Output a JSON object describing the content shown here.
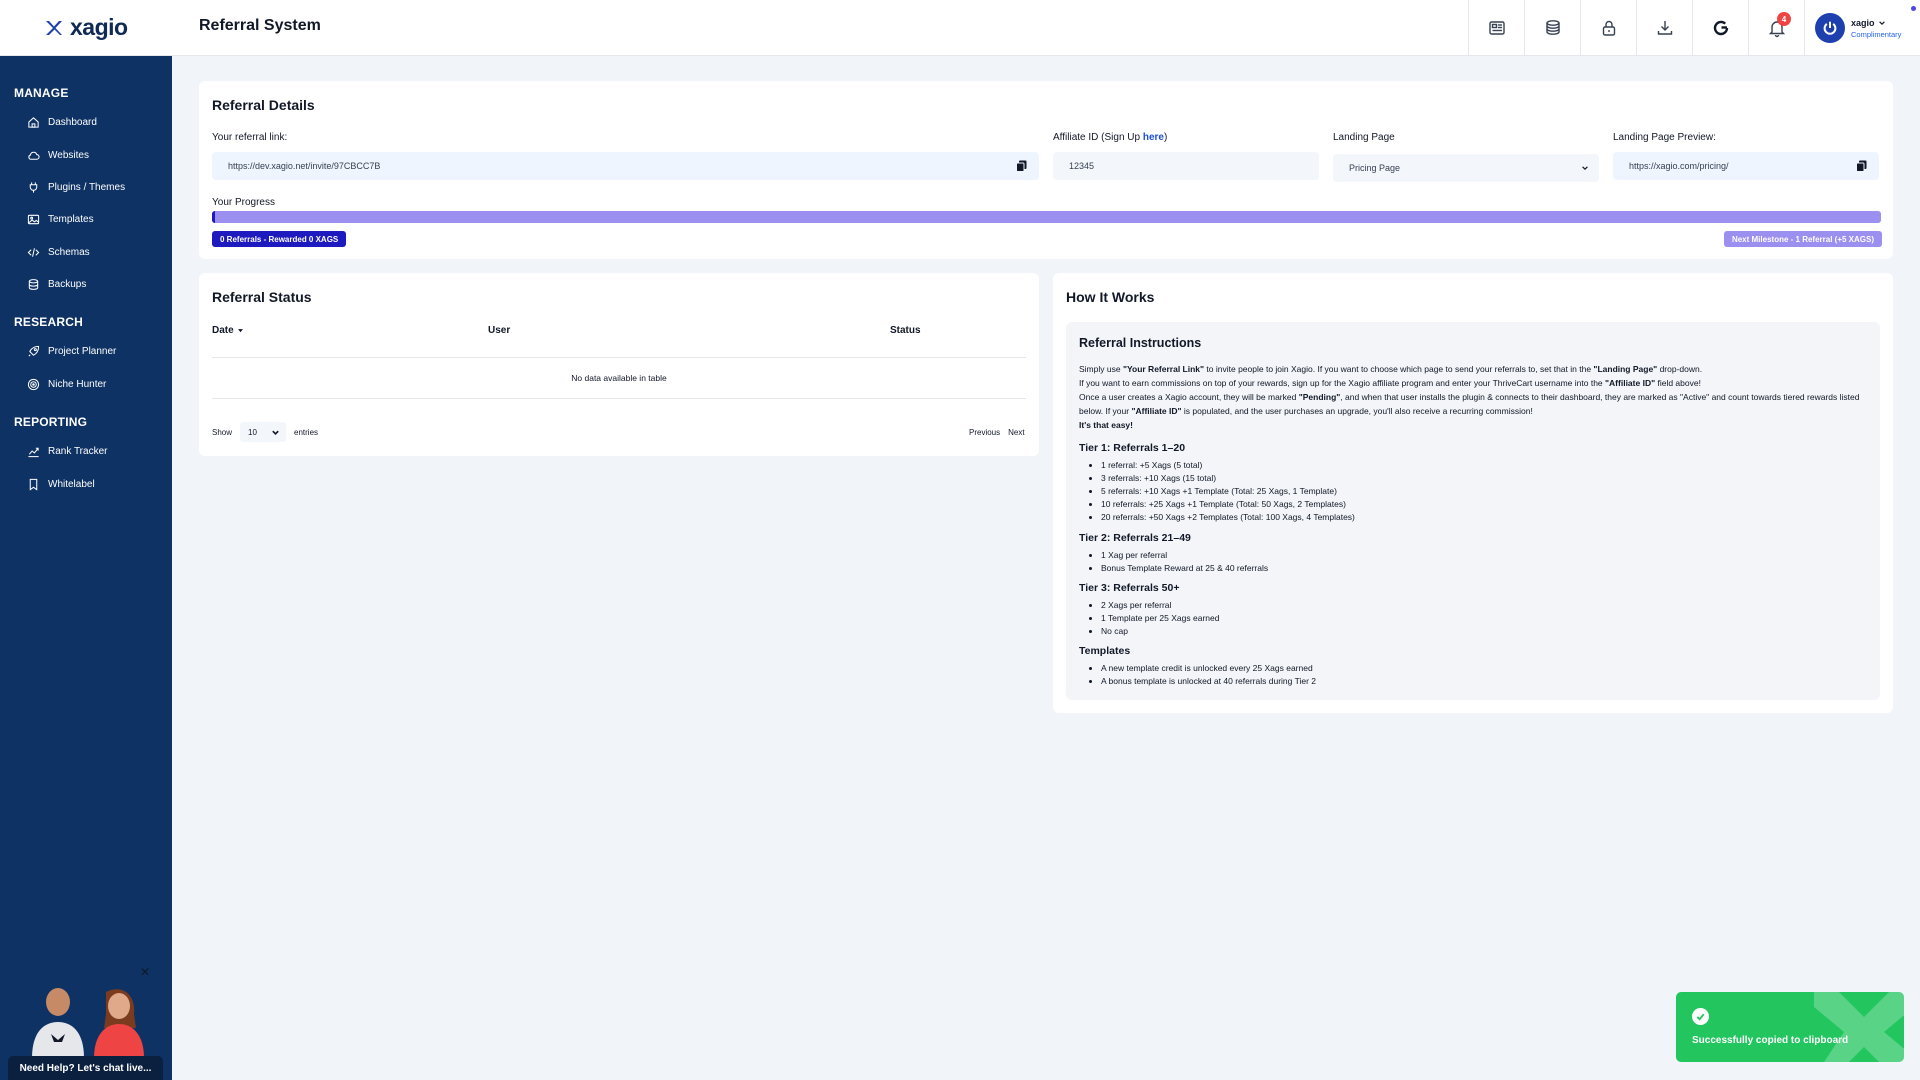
{
  "app": {
    "logo_text": "xagio",
    "page_title": "Referral System"
  },
  "header": {
    "icons": [
      "newspaper-icon",
      "coins-icon",
      "lock-icon",
      "download-icon",
      "google-icon",
      "bell-icon"
    ],
    "notification_count": "4",
    "user_name": "xagio",
    "user_plan": "Complimentary"
  },
  "sidebar": {
    "sections": [
      {
        "label": "MANAGE",
        "items": [
          {
            "label": "Dashboard",
            "icon": "home-icon"
          },
          {
            "label": "Websites",
            "icon": "cloud-icon"
          },
          {
            "label": "Plugins / Themes",
            "icon": "plug-icon"
          },
          {
            "label": "Templates",
            "icon": "image-icon"
          },
          {
            "label": "Schemas",
            "icon": "code-icon"
          },
          {
            "label": "Backups",
            "icon": "database-icon"
          }
        ]
      },
      {
        "label": "RESEARCH",
        "items": [
          {
            "label": "Project Planner",
            "icon": "rocket-icon"
          },
          {
            "label": "Niche Hunter",
            "icon": "target-icon"
          }
        ]
      },
      {
        "label": "REPORTING",
        "items": [
          {
            "label": "Rank Tracker",
            "icon": "chart-icon"
          },
          {
            "label": "Whitelabel",
            "icon": "bookmark-icon"
          }
        ]
      }
    ],
    "help_text": "Need Help? Let's chat live..."
  },
  "referral_details": {
    "title": "Referral Details",
    "link_label": "Your referral link:",
    "link_value": "https://dev.xagio.net/invite/97CBCC7B",
    "affiliate_label": "Affiliate ID (Sign Up ",
    "affiliate_link_text": "here",
    "affiliate_label_end": ")",
    "affiliate_value": "12345",
    "landing_label": "Landing Page",
    "landing_value": "Pricing Page",
    "preview_label": "Landing Page Preview:",
    "preview_value": "https://xagio.com/pricing/",
    "progress_label": "Your Progress",
    "progress_fraction": 0.0,
    "progress_left": "0 Referrals - Rewarded 0 XAGS",
    "progress_right": "Next Milestone - 1 Referral (+5 XAGS)"
  },
  "referral_status": {
    "title": "Referral Status",
    "columns": [
      "Date",
      "User",
      "Status"
    ],
    "empty_text": "No data available in table",
    "show_label": "Show",
    "page_size": "10",
    "entries_label": "entries",
    "prev": "Previous",
    "next": "Next"
  },
  "how_it_works": {
    "title": "How It Works",
    "inst_title": "Referral Instructions",
    "p1_a": "Simply use ",
    "p1_b": "\"Your Referral Link\"",
    "p1_c": " to invite people to join Xagio. If you want to choose which page to send your referrals to, set that in the ",
    "p1_d": "\"Landing Page\"",
    "p1_e": " drop-down.",
    "p2_a": "If you want to earn commissions on top of your rewards, sign up for the Xagio affiliate program and enter your ThriveCart username into the ",
    "p2_b": "\"Affiliate ID\"",
    "p2_c": " field above!",
    "p3_a": "Once a user creates a Xagio account, they will be marked ",
    "p3_b": "\"Pending\"",
    "p3_c": ", and when that user installs the plugin & connects to their dashboard, they are marked as \"Active\" and count towards tiered rewards listed below. If your ",
    "p3_d": "\"Affiliate ID\"",
    "p3_e": " is populated, and the user purchases an upgrade, you'll also receive a recurring commission!",
    "p4": "It's that easy!",
    "tiers": [
      {
        "title": "Tier 1: Referrals 1–20",
        "items": [
          "1 referral: +5 Xags (5 total)",
          "3 referrals: +10 Xags (15 total)",
          "5 referrals: +10 Xags +1 Template (Total: 25 Xags, 1 Template)",
          "10 referrals: +25 Xags +1 Template (Total: 50 Xags, 2 Templates)",
          "20 referrals: +50 Xags +2 Templates (Total: 100 Xags, 4 Templates)"
        ]
      },
      {
        "title": "Tier 2: Referrals 21–49",
        "items": [
          "1 Xag per referral",
          "Bonus Template Reward at 25 & 40 referrals"
        ]
      },
      {
        "title": "Tier 3: Referrals 50+",
        "items": [
          "2 Xags per referral",
          "1 Template per 25 Xags earned",
          "No cap"
        ]
      },
      {
        "title": "Templates",
        "items": [
          "A new template credit is unlocked every 25 Xags earned",
          "A bonus template is unlocked at 40 referrals during Tier 2"
        ]
      }
    ]
  },
  "toast": {
    "message": "Successfully copied to clipboard"
  }
}
